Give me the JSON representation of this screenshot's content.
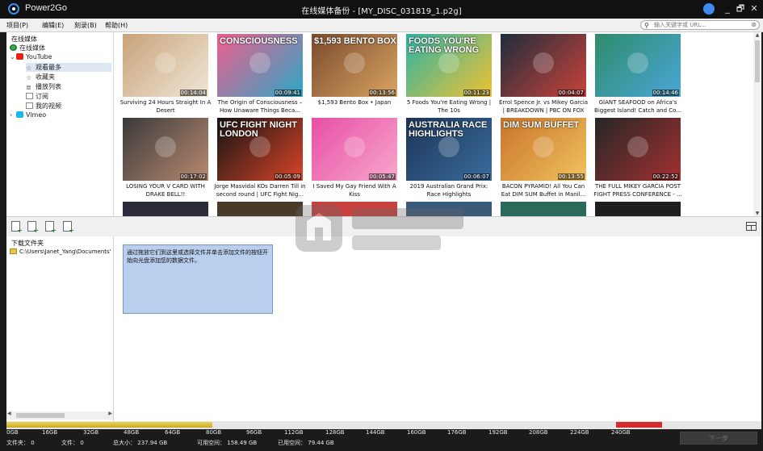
{
  "app": {
    "name": "Power2Go",
    "window_title": "在线媒体备份 - [MY_DISC_031819_1.p2g]",
    "window_controls": {
      "minimize": "_",
      "restore": "🗗",
      "close": "✕"
    }
  },
  "menu": [
    "项目(P)",
    "编辑(E)",
    "刻录(B)",
    "帮助(H)"
  ],
  "search": {
    "placeholder": "输入关键字或 URL...",
    "icon": "search-icon",
    "clear": "⊗"
  },
  "tree": {
    "heading": "在线媒体",
    "items": [
      {
        "label": "在线媒体",
        "icon": "globe-icon"
      },
      {
        "label": "YouTube",
        "icon": "youtube-icon",
        "expander": "⌄"
      },
      {
        "label": "观看最多",
        "icon": "star-icon"
      },
      {
        "label": "收藏夹",
        "icon": "star-icon"
      },
      {
        "label": "播放列表",
        "icon": "list-icon"
      },
      {
        "label": "订阅",
        "icon": "doc-icon"
      },
      {
        "label": "我的视频",
        "icon": "doc-icon"
      },
      {
        "label": "Vimeo",
        "icon": "vimeo-icon",
        "expander": "›"
      }
    ]
  },
  "videos": [
    {
      "title": "Surviving 24 Hours Straight In A Desert",
      "duration": "00:14:04",
      "overlay": "",
      "colors": [
        "#c9a37a",
        "#efe6d6"
      ]
    },
    {
      "title": "The Origin of Consciousness – How Unaware Things Beca...",
      "duration": "00:09:41",
      "overlay": "CONSCIOUSNESS",
      "colors": [
        "#f05d8d",
        "#2aa8c6"
      ]
    },
    {
      "title": "$1,593 Bento Box • Japan",
      "duration": "00:13:56",
      "overlay": "$1,593 BENTO BOX",
      "colors": [
        "#7a4a2c",
        "#d9a463"
      ]
    },
    {
      "title": "5 Foods You're Eating Wrong | The 10s",
      "duration": "00:11:23",
      "overlay": "FOODS YOU'RE EATING WRONG",
      "colors": [
        "#2cb3a4",
        "#f1c233"
      ]
    },
    {
      "title": "Errol Spence Jr. vs Mikey Garcia | BREAKDOWN | PBC ON FOX",
      "duration": "00:04:07",
      "overlay": "",
      "colors": [
        "#1f2d3c",
        "#c9423a"
      ]
    },
    {
      "title": "GIANT SEAFOOD on Africa's Biggest Island! Catch and Co...",
      "duration": "00:14:46",
      "overlay": "",
      "colors": [
        "#2e8c6a",
        "#4aa6d8"
      ]
    },
    {
      "title": "LOSING YOUR V CARD WITH DRAKE BELL!!",
      "duration": "00:17:02",
      "overlay": "",
      "colors": [
        "#3a3a3a",
        "#b98a70"
      ]
    },
    {
      "title": "Jorge Masvidal KOs Darren Till in second round | UFC Fight Nig...",
      "duration": "00:05:09",
      "overlay": "UFC FIGHT NIGHT LONDON",
      "colors": [
        "#141414",
        "#d94427"
      ]
    },
    {
      "title": "I Saved My Gay Friend With A Kiss",
      "duration": "00:05:47",
      "overlay": "",
      "colors": [
        "#e84fa6",
        "#f7a7cc"
      ]
    },
    {
      "title": "2019 Australian Grand Prix: Race Highlights",
      "duration": "00:06:07",
      "overlay": "AUSTRALIA RACE HIGHLIGHTS",
      "colors": [
        "#1c3556",
        "#3a6c9e"
      ]
    },
    {
      "title": "BACON PYRAMID! All You Can Eat DIM SUM Buffet in Manil...",
      "duration": "00:13:55",
      "overlay": "DIM SUM BUFFET",
      "colors": [
        "#c7742c",
        "#f2c25d"
      ]
    },
    {
      "title": "THE FULL MIKEY GARCIA POST FIGHT PRESS CONFERENCE - ...",
      "duration": "00:22:52",
      "overlay": "",
      "colors": [
        "#262626",
        "#a33030"
      ]
    }
  ],
  "lower": {
    "heading": "下载文件夹",
    "folder_path": "C:\\Users\\Janet_Yang\\Documents'",
    "hint": "通过拖放它们到这里或选择文件并单击添加文件的按钮开始向光盘添加您的数据文件。"
  },
  "capacity": {
    "ticks": [
      "0GB",
      "16GB",
      "32GB",
      "48GB",
      "64GB",
      "80GB",
      "96GB",
      "112GB",
      "128GB",
      "144GB",
      "160GB",
      "176GB",
      "192GB",
      "208GB",
      "224GB",
      "240GB"
    ],
    "used_color": "#d8bd3c",
    "over_color": "#d52b2b"
  },
  "status": {
    "folders_label": "文件夹：",
    "folders_value": "0",
    "files_label": "文件：",
    "files_value": "0",
    "total_label": "总大小：",
    "total_value": "237.94 GB",
    "free_label": "可用空间：",
    "free_value": "158.49 GB",
    "used_label": "已用空间：",
    "used_value": "79.44 GB"
  },
  "next_button": "下一步"
}
